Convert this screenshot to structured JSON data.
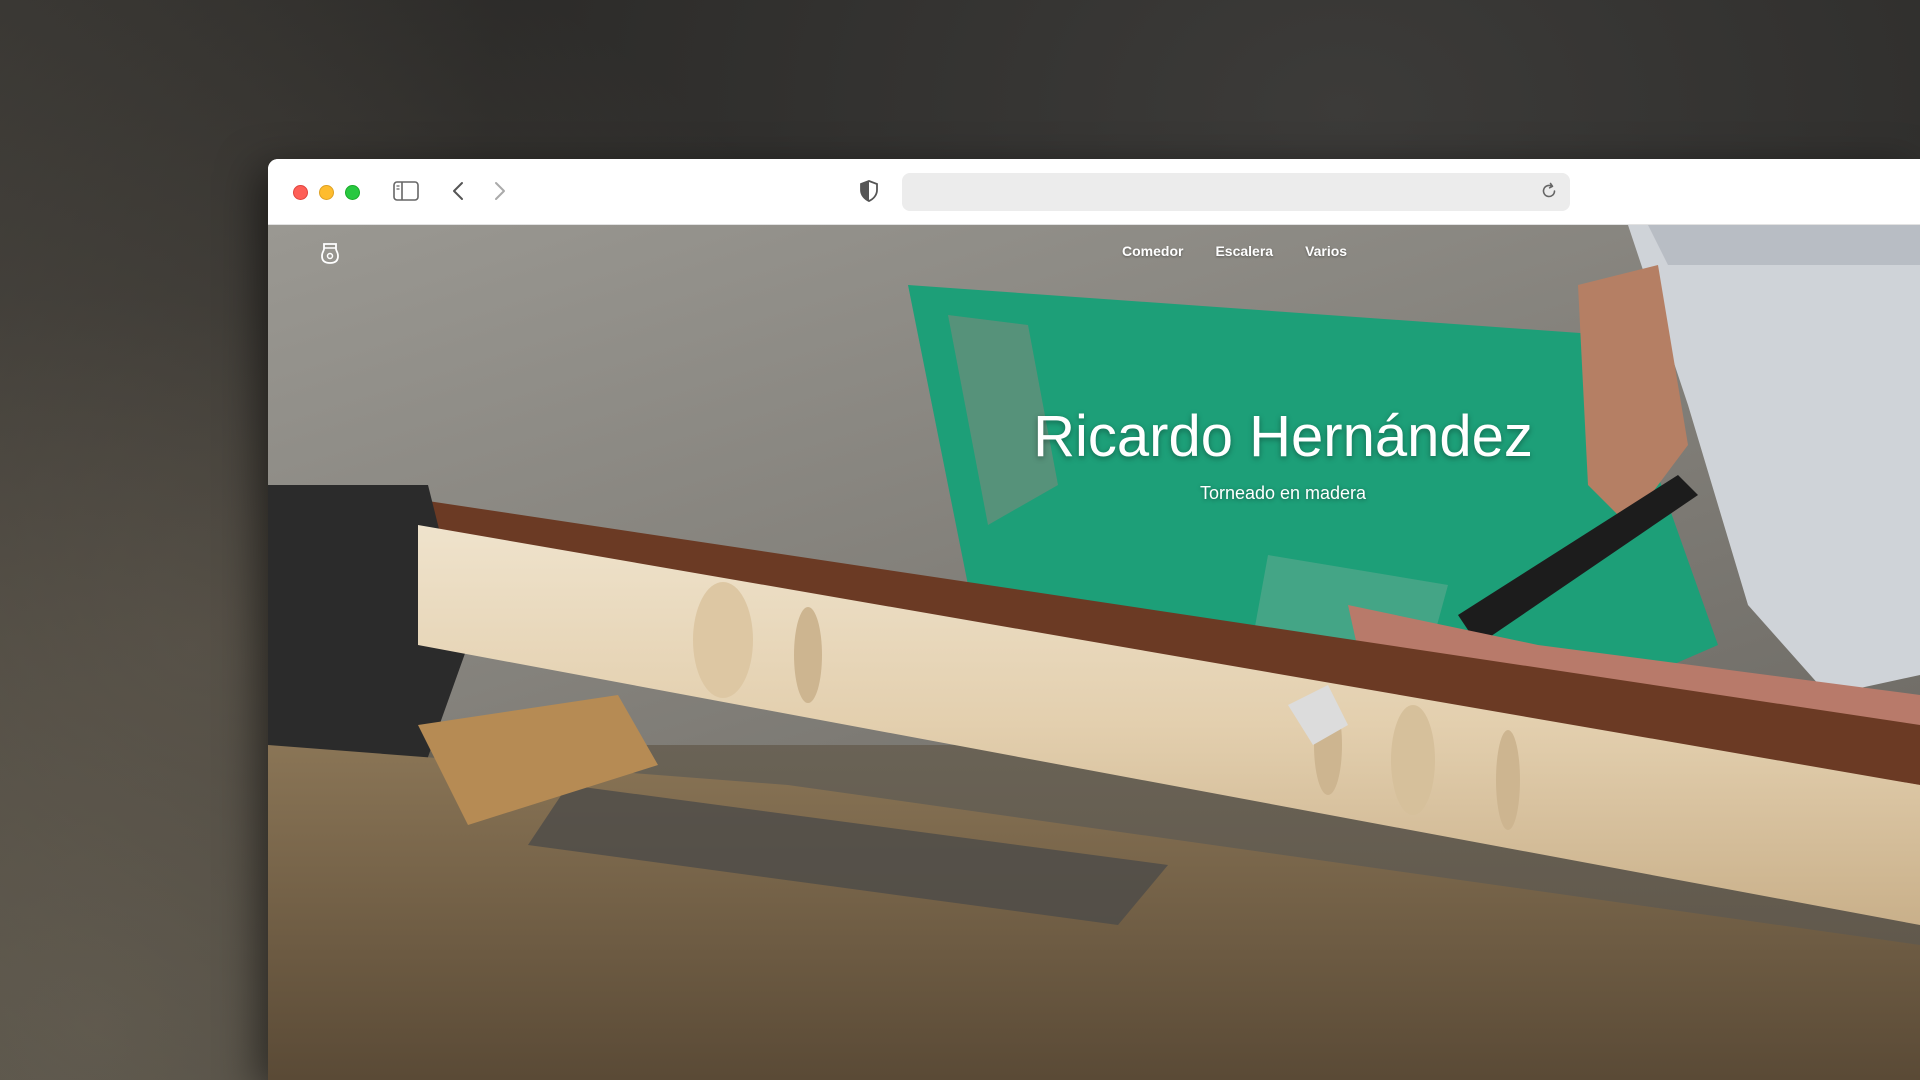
{
  "browser": {
    "address_value": "",
    "icons": {
      "sidebar": "sidebar-icon",
      "back": "chevron-left-icon",
      "forward": "chevron-right-icon",
      "privacy": "shield-icon",
      "reload": "reload-icon"
    }
  },
  "site": {
    "logo_icon": "woodturner-logo-icon",
    "nav": [
      {
        "label": "Comedor"
      },
      {
        "label": "Escalera"
      },
      {
        "label": "Varios"
      }
    ],
    "hero": {
      "title": "Ricardo Hernández",
      "subtitle": "Torneado en madera"
    }
  },
  "colors": {
    "traffic_red": "#fe5f57",
    "traffic_yellow": "#febc2e",
    "traffic_green": "#28c840",
    "wall_green": "#1d9f78",
    "wood": "#e6d3b3"
  }
}
